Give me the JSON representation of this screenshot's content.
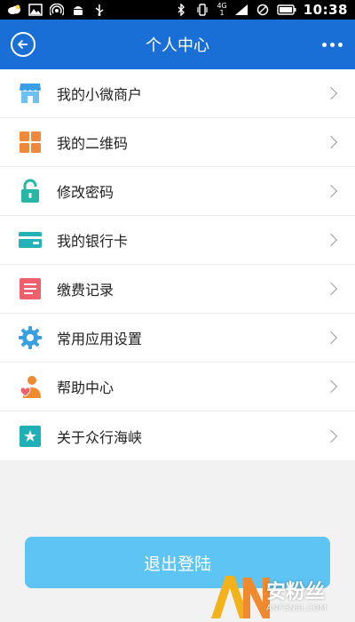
{
  "status_bar": {
    "network_top": "4G",
    "network_bottom": "1",
    "time": "10:38"
  },
  "header": {
    "title": "个人中心",
    "back_icon": "back-arrow-circle-icon",
    "more_icon": "more-dots-icon"
  },
  "menu": {
    "items": [
      {
        "label": "我的小微商户",
        "icon": "shop-icon",
        "color": "#3aa0e6"
      },
      {
        "label": "我的二维码",
        "icon": "qrcode-icon",
        "color": "#f0883a"
      },
      {
        "label": "修改密码",
        "icon": "lock-icon",
        "color": "#27b7a6"
      },
      {
        "label": "我的银行卡",
        "icon": "bank-card-icon",
        "color": "#24b1b8"
      },
      {
        "label": "缴费记录",
        "icon": "record-icon",
        "color": "#ef5f6c"
      },
      {
        "label": "常用应用设置",
        "icon": "gear-icon",
        "color": "#3a9fe0"
      },
      {
        "label": "帮助中心",
        "icon": "help-person-icon",
        "color": "#f08a2e"
      },
      {
        "label": "关于众行海峡",
        "icon": "star-box-icon",
        "color": "#1fb0b6"
      }
    ]
  },
  "logout": {
    "label": "退出登陆",
    "color": "#5ec4f3"
  },
  "watermark": {
    "mark": "AN",
    "cn": "安粉丝",
    "en": "ANFENSI.COM"
  },
  "colors": {
    "primary": "#1a6fd6",
    "background": "#f2f2f2"
  }
}
